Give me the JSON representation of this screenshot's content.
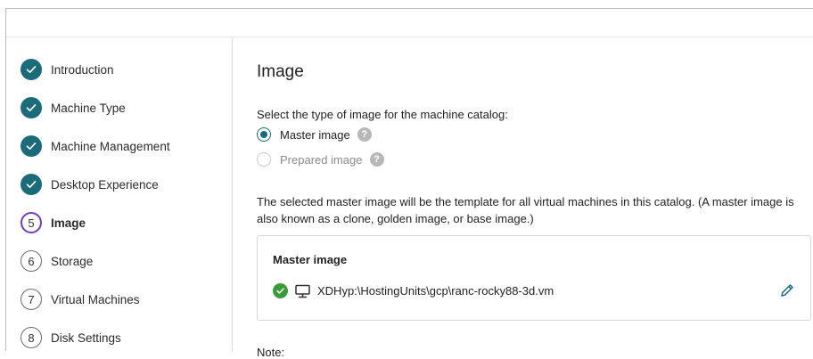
{
  "sidebar": {
    "steps": [
      {
        "label": "Introduction",
        "status": "done"
      },
      {
        "label": "Machine Type",
        "status": "done"
      },
      {
        "label": "Machine Management",
        "status": "done"
      },
      {
        "label": "Desktop Experience",
        "status": "done"
      },
      {
        "label": "Image",
        "status": "active",
        "number": "5"
      },
      {
        "label": "Storage",
        "status": "pending",
        "number": "6"
      },
      {
        "label": "Virtual Machines",
        "status": "pending",
        "number": "7"
      },
      {
        "label": "Disk Settings",
        "status": "pending",
        "number": "8"
      }
    ]
  },
  "main": {
    "title": "Image",
    "prompt": "Select the type of image for the machine catalog:",
    "options": [
      {
        "label": "Master image",
        "selected": true,
        "help_icon": "question-icon"
      },
      {
        "label": "Prepared image",
        "selected": false,
        "help_icon": "question-icon"
      }
    ],
    "description": "The selected master image will be the template for all virtual machines in this catalog. (A master image is also known as a clone, golden image, or base image.)",
    "card": {
      "title": "Master image",
      "status_icon": "check-circle-icon",
      "type_icon": "monitor-icon",
      "path": "XDHyp:\\HostingUnits\\gcp\\ranc-rocky88-3d.vm",
      "edit_icon": "pencil-icon"
    },
    "note_label": "Note:"
  },
  "colors": {
    "accent_teal": "#1b6b7a",
    "active_step_ring": "#6b3fbf",
    "success_green": "#3a9b3a"
  }
}
